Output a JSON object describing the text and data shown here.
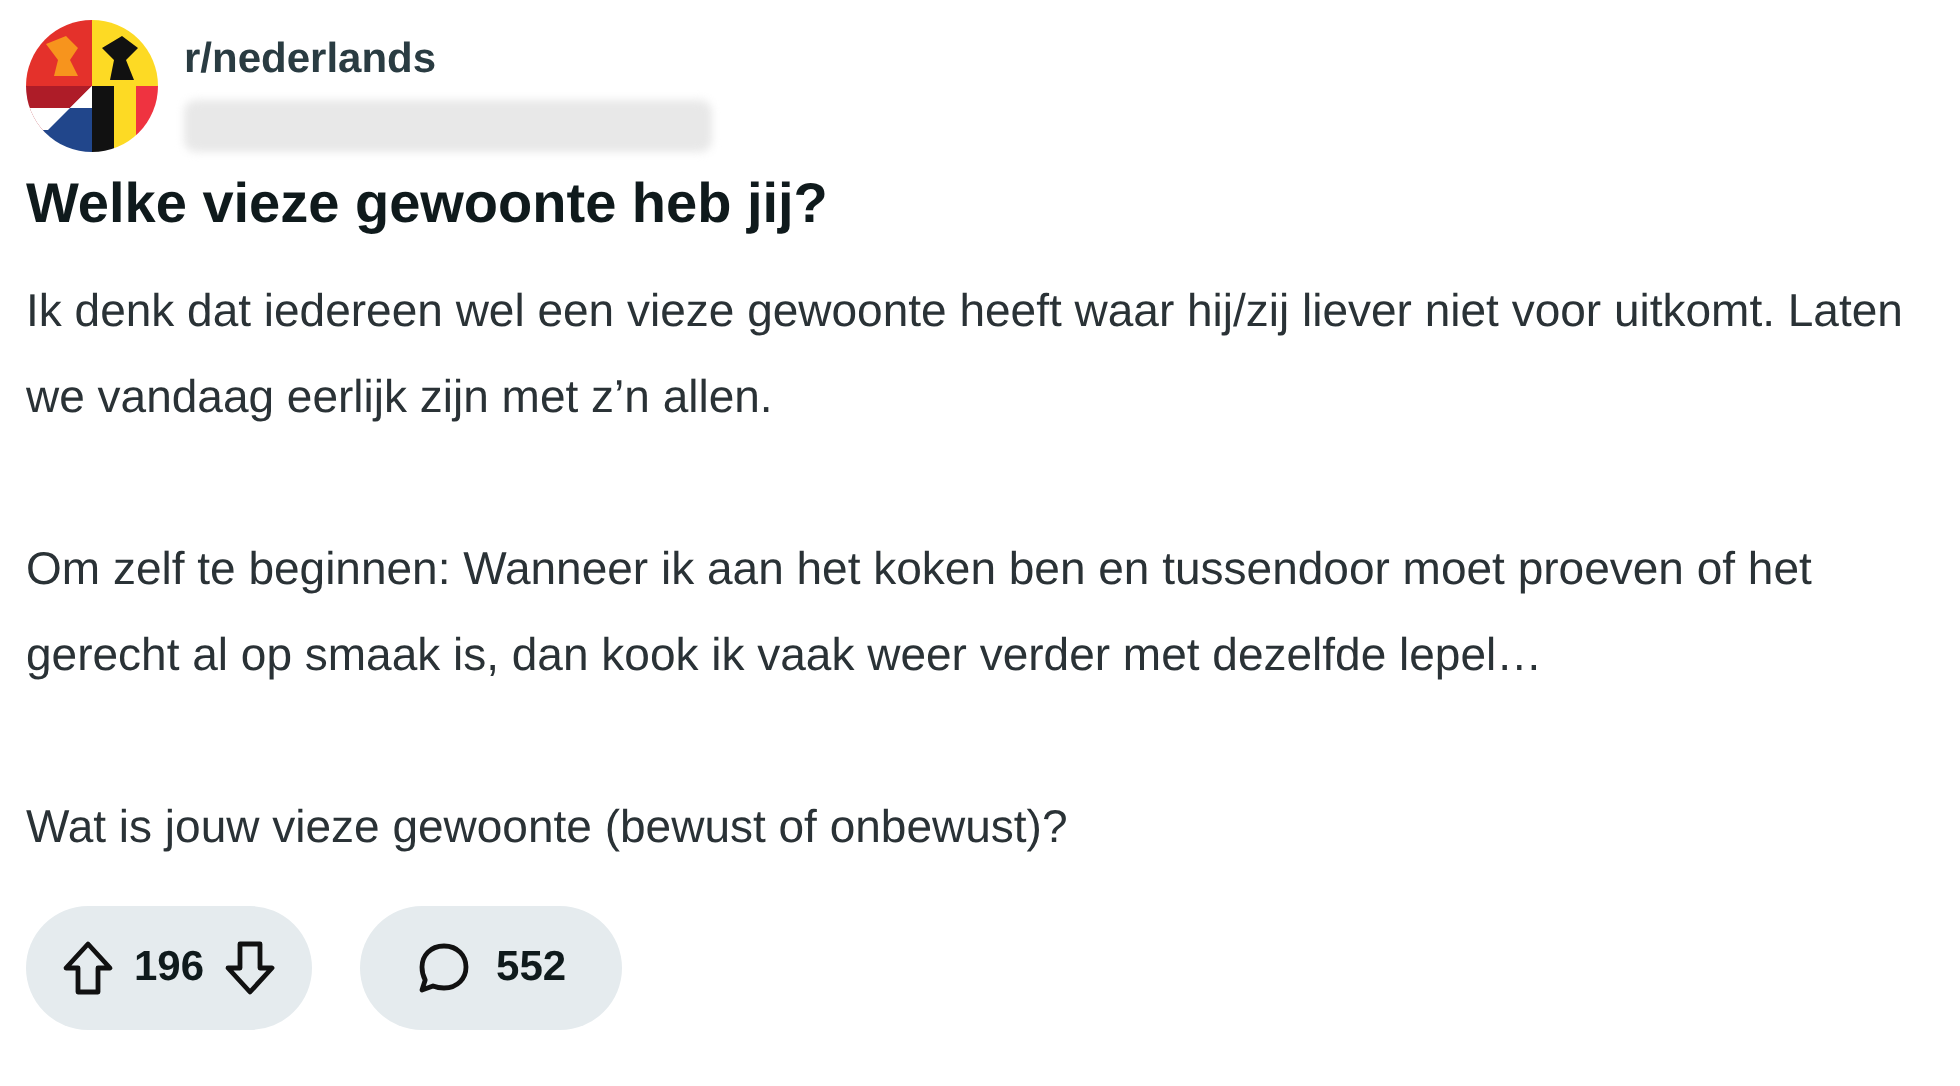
{
  "post": {
    "subreddit": "r/nederlands",
    "title": "Welke vieze gewoonte heb jij?",
    "paragraphs": [
      "Ik denk dat iedereen wel een vieze gewoonte heeft waar hij/zij liever niet voor uitkomt. Laten we vandaag eerlijk zijn met z’n allen.",
      "Om zelf te beginnen: Wanneer ik aan het koken ben en tussendoor moet proeven of het gerecht al op smaak is, dan kook ik vaak weer verder met dezelfde lepel…",
      "Wat is jouw vieze gewoonte (bewust of onbewust)?"
    ],
    "votes": "196",
    "comments": "552"
  }
}
